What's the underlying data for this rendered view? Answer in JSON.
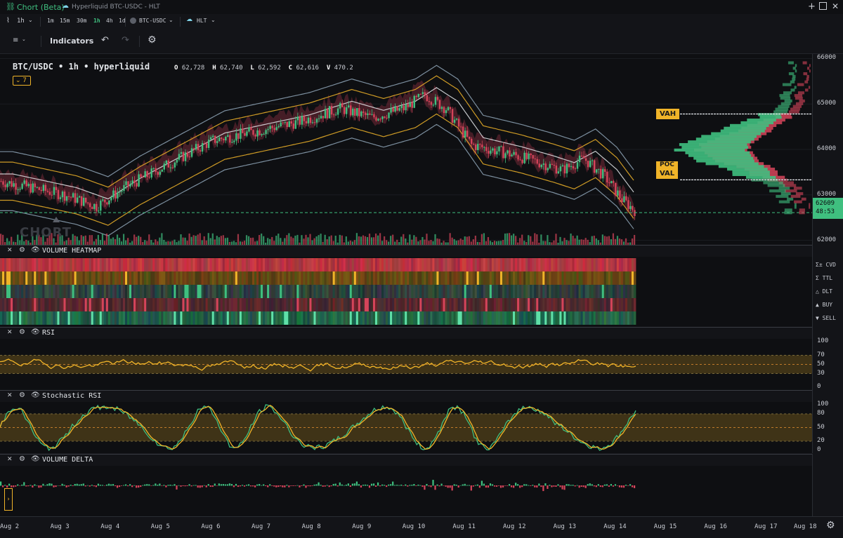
{
  "window": {
    "app_title": "Chort (Beta)",
    "doc_title": "Hyperliquid BTC-USDC - HLT"
  },
  "toolbar": {
    "interval": "1h",
    "intervals": [
      "1m",
      "15m",
      "30m",
      "1h",
      "4h",
      "1d"
    ],
    "active_interval": "1h",
    "symbol": "BTC-USDC",
    "exchange": "HLT",
    "indicators_label": "Indicators"
  },
  "legend": {
    "title": "BTC/USDC • 1h • hyperliquid",
    "o_label": "O",
    "o_value": "62,728",
    "h_label": "H",
    "h_value": "62,740",
    "l_label": "L",
    "l_value": "62,592",
    "c_label": "C",
    "c_value": "62,616",
    "v_label": "V",
    "v_value": "470.2",
    "collapse_count": "7"
  },
  "main_chart": {
    "watermark": "CHORT",
    "price_ticks": [
      "66000",
      "65000",
      "64000",
      "63000",
      "62000"
    ],
    "price_ticks_values": [
      66000,
      65000,
      64000,
      63000,
      62000
    ],
    "y_range": [
      61900,
      66100
    ],
    "current_price": "62609",
    "countdown": "48:53",
    "vah_label": "VAH",
    "val_label": "VAL",
    "poc_label": "POC",
    "vah_price": 64780,
    "val_price": 63330
  },
  "panes": {
    "heatmap": {
      "title": "VOLUME HEATMAP",
      "rows": [
        {
          "icon": "Σ±",
          "label": "CVD"
        },
        {
          "icon": "Σ",
          "label": "TTL"
        },
        {
          "icon": "△",
          "label": "DLT"
        },
        {
          "icon": "▲",
          "label": "BUY"
        },
        {
          "icon": "▼",
          "label": "SELL"
        }
      ]
    },
    "rsi": {
      "title": "RSI",
      "ticks": [
        "100",
        "70",
        "50",
        "30",
        "0"
      ],
      "tick_values": [
        100,
        70,
        50,
        30,
        0
      ]
    },
    "stoch": {
      "title": "Stochastic RSI",
      "ticks": [
        "100",
        "80",
        "50",
        "20",
        "0"
      ],
      "tick_values": [
        100,
        80,
        50,
        20,
        0
      ]
    },
    "delta": {
      "title": "VOLUME DELTA"
    }
  },
  "time_axis": {
    "labels": [
      "Aug 2",
      "Aug 3",
      "Aug 4",
      "Aug 5",
      "Aug 6",
      "Aug 7",
      "Aug 8",
      "Aug 9",
      "Aug 10",
      "Aug 11",
      "Aug 12",
      "Aug 13",
      "Aug 14",
      "Aug 15",
      "Aug 16",
      "Aug 17",
      "Aug 18"
    ]
  },
  "colors": {
    "up": "#3fbf7f",
    "down": "#d5445a",
    "accent": "#f0b429",
    "bg": "#0e0f12"
  }
}
